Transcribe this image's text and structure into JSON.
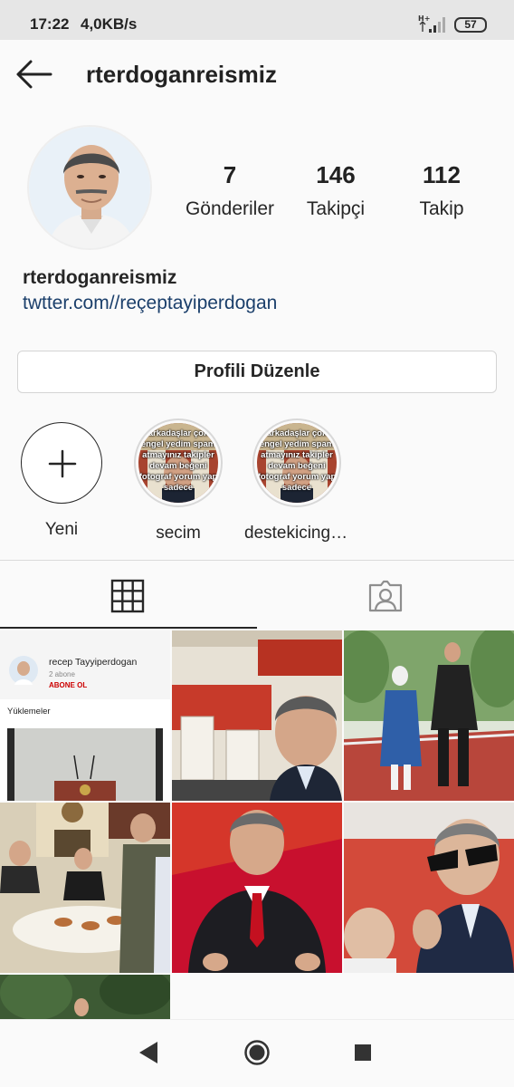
{
  "status_bar": {
    "time": "17:22",
    "speed": "4,0KB/s",
    "battery": "57",
    "network": "H+"
  },
  "header": {
    "username": "rterdoganreismiz"
  },
  "stats": [
    {
      "count": "7",
      "label": "Gönderiler"
    },
    {
      "count": "146",
      "label": "Takipçi"
    },
    {
      "count": "112",
      "label": "Takip"
    }
  ],
  "bio": {
    "name": "rterdoganreismiz",
    "link": "twtter.com//reçeptayiperdogan"
  },
  "edit_profile_label": "Profili Düzenle",
  "highlights": [
    {
      "label": "Yeni"
    },
    {
      "label": "secim",
      "cover_text": "arkadaşlar çok engel yedim spam atmayınız takipler devam beğeni fotograf yorum yap sadece"
    },
    {
      "label": "destekicingt…",
      "cover_text": "arkadaşlar çok engel yedim spam atmayınız takipler devam beğeni fotograf yorum yap sadece"
    }
  ],
  "grid_post1": {
    "channel": "recep Tayyiperdogan",
    "subs": "2 abone",
    "subscribe": "ABONE OL",
    "uploads": "Yüklemeler"
  },
  "icons": {
    "back": "back-arrow-icon",
    "grid": "grid-icon",
    "tagged": "tagged-person-icon",
    "nav_back": "triangle-back-icon",
    "nav_home": "circle-home-icon",
    "nav_recent": "square-recent-icon"
  },
  "colors": {
    "link": "#1b3f6b",
    "accent_red": "#c8102e"
  }
}
